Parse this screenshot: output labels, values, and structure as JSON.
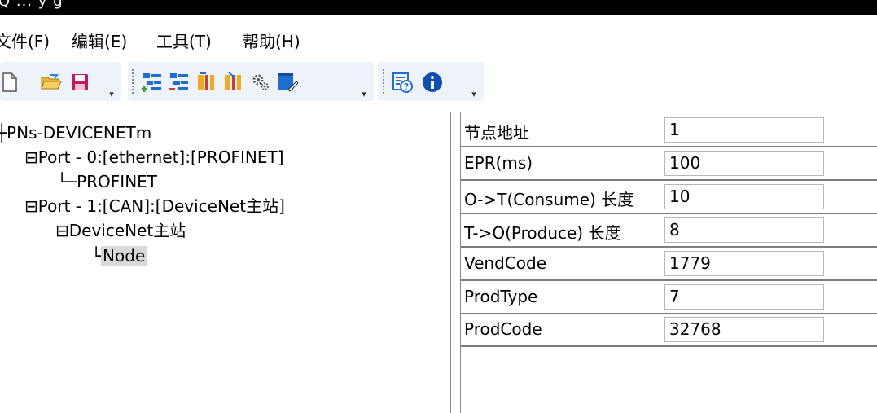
{
  "window": {
    "title": "Q ... y   g"
  },
  "menu": {
    "items": [
      {
        "label": "文件(F)"
      },
      {
        "label": "编辑(E)"
      },
      {
        "label": "工具(T)"
      },
      {
        "label": "帮助(H)"
      }
    ]
  },
  "toolbar": {
    "groups": [
      {
        "icons": [
          "new-file-icon",
          "open-folder-icon",
          "save-icon"
        ]
      },
      {
        "icons": [
          "add-node-icon",
          "remove-node-icon",
          "upload-icon",
          "download-icon",
          "settings-gears-icon",
          "edit-note-icon"
        ]
      },
      {
        "icons": [
          "help-doc-icon",
          "info-icon"
        ]
      }
    ],
    "colors": {
      "green": "#3aa335",
      "blue": "#1f6fd1",
      "orange": "#f2a91e",
      "red": "#d23c2c"
    }
  },
  "tree": {
    "nodes": [
      {
        "label": "PNs-DEVICENETm",
        "glyph": "+",
        "level": 0
      },
      {
        "label": "Port - 0:[ethernet]:[PROFINET]",
        "glyph": "⊟",
        "level": 1
      },
      {
        "label": "PROFINET",
        "glyph": "└",
        "level": 2
      },
      {
        "label": "Port - 1:[CAN]:[DeviceNet主站]",
        "glyph": "⊟",
        "level": 1
      },
      {
        "label": "DeviceNet主站",
        "glyph": "⊟",
        "level": 2
      },
      {
        "label": "Node",
        "glyph": "└",
        "level": 3,
        "selected": true
      }
    ]
  },
  "properties": {
    "rows": [
      {
        "label": "节点地址",
        "value": "1"
      },
      {
        "label": "EPR(ms)",
        "value": "100"
      },
      {
        "label": "O->T(Consume) 长度",
        "value": "10"
      },
      {
        "label": "T->O(Produce) 长度",
        "value": "8"
      },
      {
        "label": "VendCode",
        "value": "1779"
      },
      {
        "label": "ProdType",
        "value": "7"
      },
      {
        "label": "ProdCode",
        "value": "32768"
      }
    ]
  }
}
